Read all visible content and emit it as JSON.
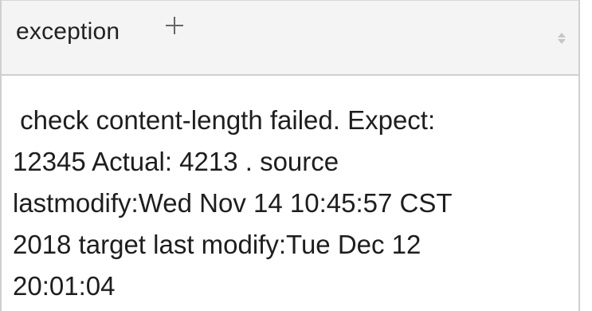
{
  "column": {
    "title": "exception",
    "add_icon": "plus-icon",
    "sort_icon": "sort-icon"
  },
  "cell": {
    "lines": [
      " check content-length failed. Expect:",
      "12345 Actual: 4213 . source",
      "lastmodify:Wed Nov 14 10:45:57 CST",
      "2018 target last modify:Tue Dec 12",
      "20:01:04"
    ]
  }
}
